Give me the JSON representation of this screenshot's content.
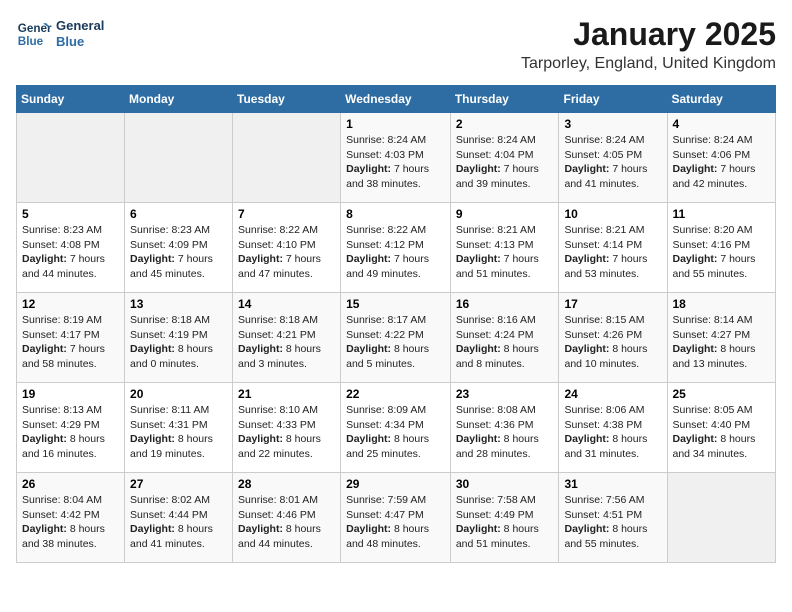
{
  "header": {
    "logo_line1": "General",
    "logo_line2": "Blue",
    "month": "January 2025",
    "location": "Tarporley, England, United Kingdom"
  },
  "weekdays": [
    "Sunday",
    "Monday",
    "Tuesday",
    "Wednesday",
    "Thursday",
    "Friday",
    "Saturday"
  ],
  "weeks": [
    [
      {
        "day": "",
        "info": ""
      },
      {
        "day": "",
        "info": ""
      },
      {
        "day": "",
        "info": ""
      },
      {
        "day": "1",
        "info": "Sunrise: 8:24 AM\nSunset: 4:03 PM\nDaylight: 7 hours and 38 minutes."
      },
      {
        "day": "2",
        "info": "Sunrise: 8:24 AM\nSunset: 4:04 PM\nDaylight: 7 hours and 39 minutes."
      },
      {
        "day": "3",
        "info": "Sunrise: 8:24 AM\nSunset: 4:05 PM\nDaylight: 7 hours and 41 minutes."
      },
      {
        "day": "4",
        "info": "Sunrise: 8:24 AM\nSunset: 4:06 PM\nDaylight: 7 hours and 42 minutes."
      }
    ],
    [
      {
        "day": "5",
        "info": "Sunrise: 8:23 AM\nSunset: 4:08 PM\nDaylight: 7 hours and 44 minutes."
      },
      {
        "day": "6",
        "info": "Sunrise: 8:23 AM\nSunset: 4:09 PM\nDaylight: 7 hours and 45 minutes."
      },
      {
        "day": "7",
        "info": "Sunrise: 8:22 AM\nSunset: 4:10 PM\nDaylight: 7 hours and 47 minutes."
      },
      {
        "day": "8",
        "info": "Sunrise: 8:22 AM\nSunset: 4:12 PM\nDaylight: 7 hours and 49 minutes."
      },
      {
        "day": "9",
        "info": "Sunrise: 8:21 AM\nSunset: 4:13 PM\nDaylight: 7 hours and 51 minutes."
      },
      {
        "day": "10",
        "info": "Sunrise: 8:21 AM\nSunset: 4:14 PM\nDaylight: 7 hours and 53 minutes."
      },
      {
        "day": "11",
        "info": "Sunrise: 8:20 AM\nSunset: 4:16 PM\nDaylight: 7 hours and 55 minutes."
      }
    ],
    [
      {
        "day": "12",
        "info": "Sunrise: 8:19 AM\nSunset: 4:17 PM\nDaylight: 7 hours and 58 minutes."
      },
      {
        "day": "13",
        "info": "Sunrise: 8:18 AM\nSunset: 4:19 PM\nDaylight: 8 hours and 0 minutes."
      },
      {
        "day": "14",
        "info": "Sunrise: 8:18 AM\nSunset: 4:21 PM\nDaylight: 8 hours and 3 minutes."
      },
      {
        "day": "15",
        "info": "Sunrise: 8:17 AM\nSunset: 4:22 PM\nDaylight: 8 hours and 5 minutes."
      },
      {
        "day": "16",
        "info": "Sunrise: 8:16 AM\nSunset: 4:24 PM\nDaylight: 8 hours and 8 minutes."
      },
      {
        "day": "17",
        "info": "Sunrise: 8:15 AM\nSunset: 4:26 PM\nDaylight: 8 hours and 10 minutes."
      },
      {
        "day": "18",
        "info": "Sunrise: 8:14 AM\nSunset: 4:27 PM\nDaylight: 8 hours and 13 minutes."
      }
    ],
    [
      {
        "day": "19",
        "info": "Sunrise: 8:13 AM\nSunset: 4:29 PM\nDaylight: 8 hours and 16 minutes."
      },
      {
        "day": "20",
        "info": "Sunrise: 8:11 AM\nSunset: 4:31 PM\nDaylight: 8 hours and 19 minutes."
      },
      {
        "day": "21",
        "info": "Sunrise: 8:10 AM\nSunset: 4:33 PM\nDaylight: 8 hours and 22 minutes."
      },
      {
        "day": "22",
        "info": "Sunrise: 8:09 AM\nSunset: 4:34 PM\nDaylight: 8 hours and 25 minutes."
      },
      {
        "day": "23",
        "info": "Sunrise: 8:08 AM\nSunset: 4:36 PM\nDaylight: 8 hours and 28 minutes."
      },
      {
        "day": "24",
        "info": "Sunrise: 8:06 AM\nSunset: 4:38 PM\nDaylight: 8 hours and 31 minutes."
      },
      {
        "day": "25",
        "info": "Sunrise: 8:05 AM\nSunset: 4:40 PM\nDaylight: 8 hours and 34 minutes."
      }
    ],
    [
      {
        "day": "26",
        "info": "Sunrise: 8:04 AM\nSunset: 4:42 PM\nDaylight: 8 hours and 38 minutes."
      },
      {
        "day": "27",
        "info": "Sunrise: 8:02 AM\nSunset: 4:44 PM\nDaylight: 8 hours and 41 minutes."
      },
      {
        "day": "28",
        "info": "Sunrise: 8:01 AM\nSunset: 4:46 PM\nDaylight: 8 hours and 44 minutes."
      },
      {
        "day": "29",
        "info": "Sunrise: 7:59 AM\nSunset: 4:47 PM\nDaylight: 8 hours and 48 minutes."
      },
      {
        "day": "30",
        "info": "Sunrise: 7:58 AM\nSunset: 4:49 PM\nDaylight: 8 hours and 51 minutes."
      },
      {
        "day": "31",
        "info": "Sunrise: 7:56 AM\nSunset: 4:51 PM\nDaylight: 8 hours and 55 minutes."
      },
      {
        "day": "",
        "info": ""
      }
    ]
  ]
}
